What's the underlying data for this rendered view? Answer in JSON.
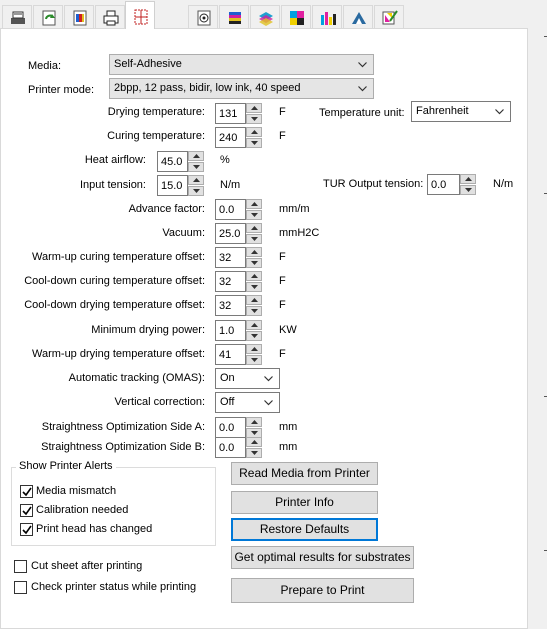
{
  "tabs": [
    {
      "icon": "printer-settings-icon",
      "active": false
    },
    {
      "icon": "refresh-media-icon",
      "active": false
    },
    {
      "icon": "color-swatch-icon",
      "active": false
    },
    {
      "icon": "printer-icon",
      "active": false
    },
    {
      "icon": "page-layout-icon",
      "active": true
    },
    {
      "icon": "target-icon",
      "active": false
    },
    {
      "icon": "color-bars-icon",
      "active": false
    },
    {
      "icon": "ink-layers-icon",
      "active": false
    },
    {
      "icon": "cmyk-squares-icon",
      "active": false
    },
    {
      "icon": "ink-levels-icon",
      "active": false
    },
    {
      "icon": "gamut-icon",
      "active": false
    },
    {
      "icon": "color-brush-icon",
      "active": false
    }
  ],
  "media": {
    "label": "Media:",
    "value": "Self-Adhesive"
  },
  "printer_mode": {
    "label": "Printer mode:",
    "value": "2bpp, 12 pass, bidir, low ink, 40 speed"
  },
  "drying_temp": {
    "label": "Drying temperature:",
    "value": "131",
    "unit": "F"
  },
  "temp_unit": {
    "label": "Temperature unit:",
    "value": "Fahrenheit"
  },
  "curing_temp": {
    "label": "Curing temperature:",
    "value": "240",
    "unit": "F"
  },
  "heat_airflow": {
    "label": "Heat airflow:",
    "value": "45.0",
    "unit": "%"
  },
  "input_tension": {
    "label": "Input tension:",
    "value": "15.0",
    "unit": "N/m"
  },
  "tur_output_tension": {
    "label": "TUR Output tension:",
    "value": "0.0",
    "unit": "N/m"
  },
  "advance_factor": {
    "label": "Advance factor:",
    "value": "0.0",
    "unit": "mm/m"
  },
  "vacuum": {
    "label": "Vacuum:",
    "value": "25.0",
    "unit": "mmH2C"
  },
  "warmup_curing_offset": {
    "label": "Warm-up curing temperature offset:",
    "value": "32",
    "unit": "F"
  },
  "cooldown_curing_offset": {
    "label": "Cool-down curing temperature offset:",
    "value": "32",
    "unit": "F"
  },
  "cooldown_drying_offset": {
    "label": "Cool-down drying temperature offset:",
    "value": "32",
    "unit": "F"
  },
  "min_drying_power": {
    "label": "Minimum drying power:",
    "value": "1.0",
    "unit": "KW"
  },
  "warmup_drying_offset": {
    "label": "Warm-up drying temperature offset:",
    "value": "41",
    "unit": "F"
  },
  "auto_tracking": {
    "label": "Automatic tracking (OMAS):",
    "value": "On"
  },
  "vertical_correction": {
    "label": "Vertical correction:",
    "value": "Off"
  },
  "straightness_a": {
    "label": "Straightness Optimization Side A:",
    "value": "0.0",
    "unit": "mm"
  },
  "straightness_b": {
    "label": "Straightness Optimization Side B:",
    "value": "0.0",
    "unit": "mm"
  },
  "alerts": {
    "title": "Show Printer Alerts",
    "items": [
      {
        "label": "Media mismatch",
        "checked": true
      },
      {
        "label": "Calibration needed",
        "checked": true
      },
      {
        "label": "Print head has changed",
        "checked": true
      }
    ]
  },
  "options": {
    "cut_sheet": {
      "label": "Cut sheet after printing",
      "checked": false
    },
    "check_status": {
      "label": "Check printer status while printing",
      "checked": false
    }
  },
  "buttons": {
    "read_media": "Read Media from Printer",
    "printer_info": "Printer Info",
    "restore_defaults": "Restore Defaults",
    "optimal_results": "Get optimal results for substrates",
    "prepare_print": "Prepare to Print"
  }
}
